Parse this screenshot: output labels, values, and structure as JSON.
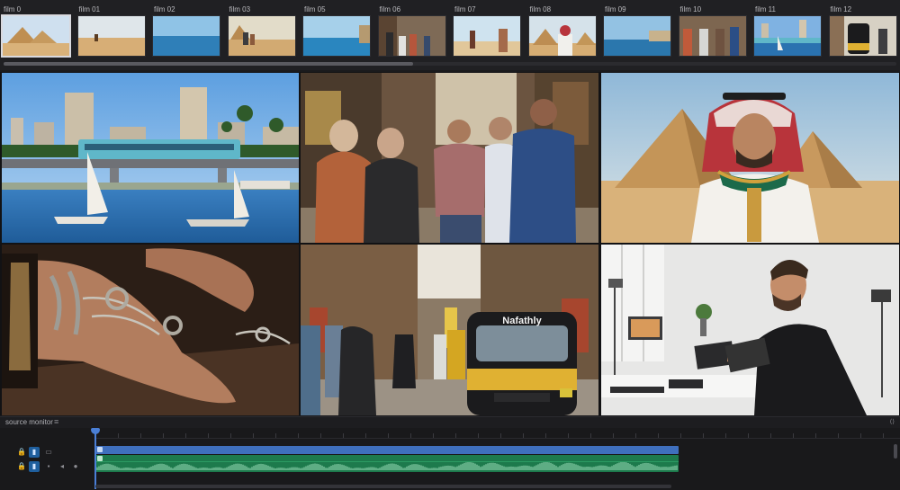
{
  "filmstrip": {
    "items": [
      {
        "label": "film 0",
        "scene": "pyramids"
      },
      {
        "label": "film 01",
        "scene": "desert-camel"
      },
      {
        "label": "film 02",
        "scene": "sea"
      },
      {
        "label": "film 03",
        "scene": "desert-people"
      },
      {
        "label": "film 05",
        "scene": "coast"
      },
      {
        "label": "film 06",
        "scene": "street-crowd"
      },
      {
        "label": "film 07",
        "scene": "beach-people"
      },
      {
        "label": "film 08",
        "scene": "man-pyramids"
      },
      {
        "label": "film 09",
        "scene": "harbor"
      },
      {
        "label": "film 10",
        "scene": "market"
      },
      {
        "label": "film 11",
        "scene": "nile-city"
      },
      {
        "label": "film 12",
        "scene": "tuktuk"
      }
    ],
    "selected_index": 0
  },
  "viewer": {
    "tiles": [
      {
        "name": "nile-city-tile",
        "scene": "nile-city"
      },
      {
        "name": "market-conversation-tile",
        "scene": "market"
      },
      {
        "name": "man-pyramids-tile",
        "scene": "man-pyramids"
      },
      {
        "name": "jewelry-hands-tile",
        "scene": "jewelry"
      },
      {
        "name": "tuktuk-street-tile",
        "scene": "tuktuk"
      },
      {
        "name": "editor-workspace-tile",
        "scene": "studio"
      }
    ],
    "tuktuk_sign": "Nafathly"
  },
  "source_monitor": {
    "label": "source monitor",
    "menu_icon": "hamburger-icon",
    "end_label": "⟨⟩"
  },
  "timeline": {
    "track_buttons": [
      {
        "icon": "lock-icon",
        "glyph": "🔒"
      },
      {
        "icon": "video-track-icon",
        "glyph": "V1"
      },
      {
        "icon": "camera-icon",
        "glyph": "▭"
      }
    ],
    "audio_buttons": [
      {
        "icon": "lock-icon",
        "glyph": "🔒"
      },
      {
        "icon": "audio-track-icon",
        "glyph": "A1"
      },
      {
        "icon": "mute-icon",
        "glyph": "M"
      },
      {
        "icon": "solo-icon",
        "glyph": "S"
      },
      {
        "icon": "mic-icon",
        "glyph": "🎙"
      }
    ],
    "colors": {
      "video_clip": "#3f6fbd",
      "audio_clip": "#1d7a4c",
      "playhead": "#4a7fd6"
    }
  }
}
